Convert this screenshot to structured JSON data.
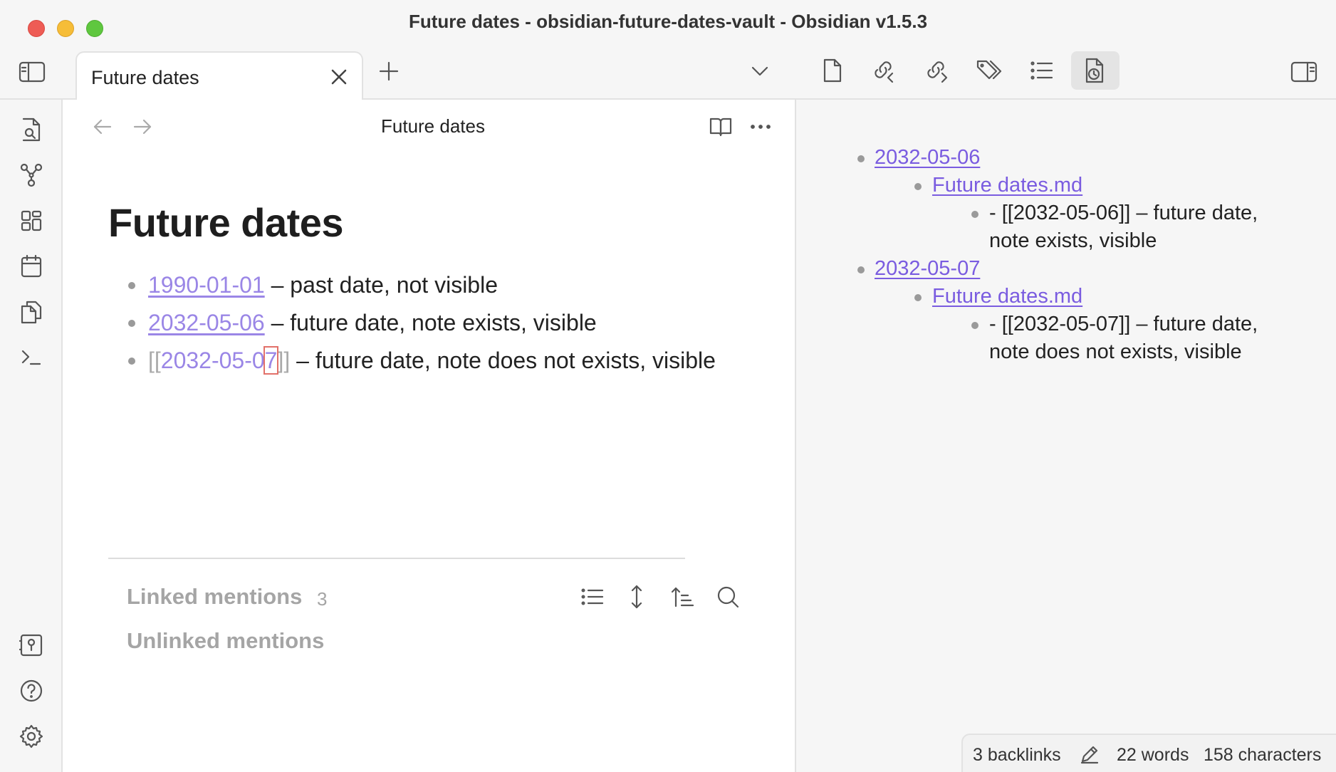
{
  "window": {
    "title": "Future dates - obsidian-future-dates-vault - Obsidian v1.5.3"
  },
  "tabs": [
    {
      "label": "Future dates"
    }
  ],
  "toolbar": {
    "icons": [
      "sidebar-left-icon",
      "plus-icon",
      "chevron-down-icon",
      "file-icon",
      "backlink-icon",
      "outgoing-link-icon",
      "tags-icon",
      "outline-icon",
      "future-dates-icon",
      "sidebar-right-icon"
    ]
  },
  "ribbon": {
    "icons": [
      "search-file-icon",
      "graph-icon",
      "canvas-icon",
      "calendar-icon",
      "copy-icon",
      "terminal-icon",
      "vault-icon",
      "help-icon",
      "settings-icon"
    ]
  },
  "editor": {
    "view_title": "Future dates",
    "note_title": "Future dates",
    "items": [
      {
        "link": "1990-01-01",
        "text": " – past date, not visible"
      },
      {
        "link": "2032-05-06",
        "text": " – future date, note exists, visible"
      },
      {
        "open": "[[",
        "link_a": "2032-05-0",
        "link_b": "7",
        "close": "]]",
        "text": " – future date, note does not exists, visible"
      }
    ],
    "linked_mentions_label": "Linked mentions",
    "linked_mentions_count": "3",
    "unlinked_mentions_label": "Unlinked mentions"
  },
  "right_pane": {
    "groups": [
      {
        "date": "2032-05-06",
        "file": "Future dates.md",
        "line1": "- [[2032-05-06]] – future date,",
        "line2": "note exists, visible"
      },
      {
        "date": "2032-05-07",
        "file": "Future dates.md",
        "line1": "- [[2032-05-07]] – future date,",
        "line2": "note does not exists, visible"
      }
    ]
  },
  "status": {
    "backlinks": "3 backlinks",
    "words": "22 words",
    "characters": "158 characters"
  },
  "colors": {
    "link_editor": "#9a86e6",
    "link_pane": "#7a5ce0",
    "cursor": "#e2716a"
  }
}
